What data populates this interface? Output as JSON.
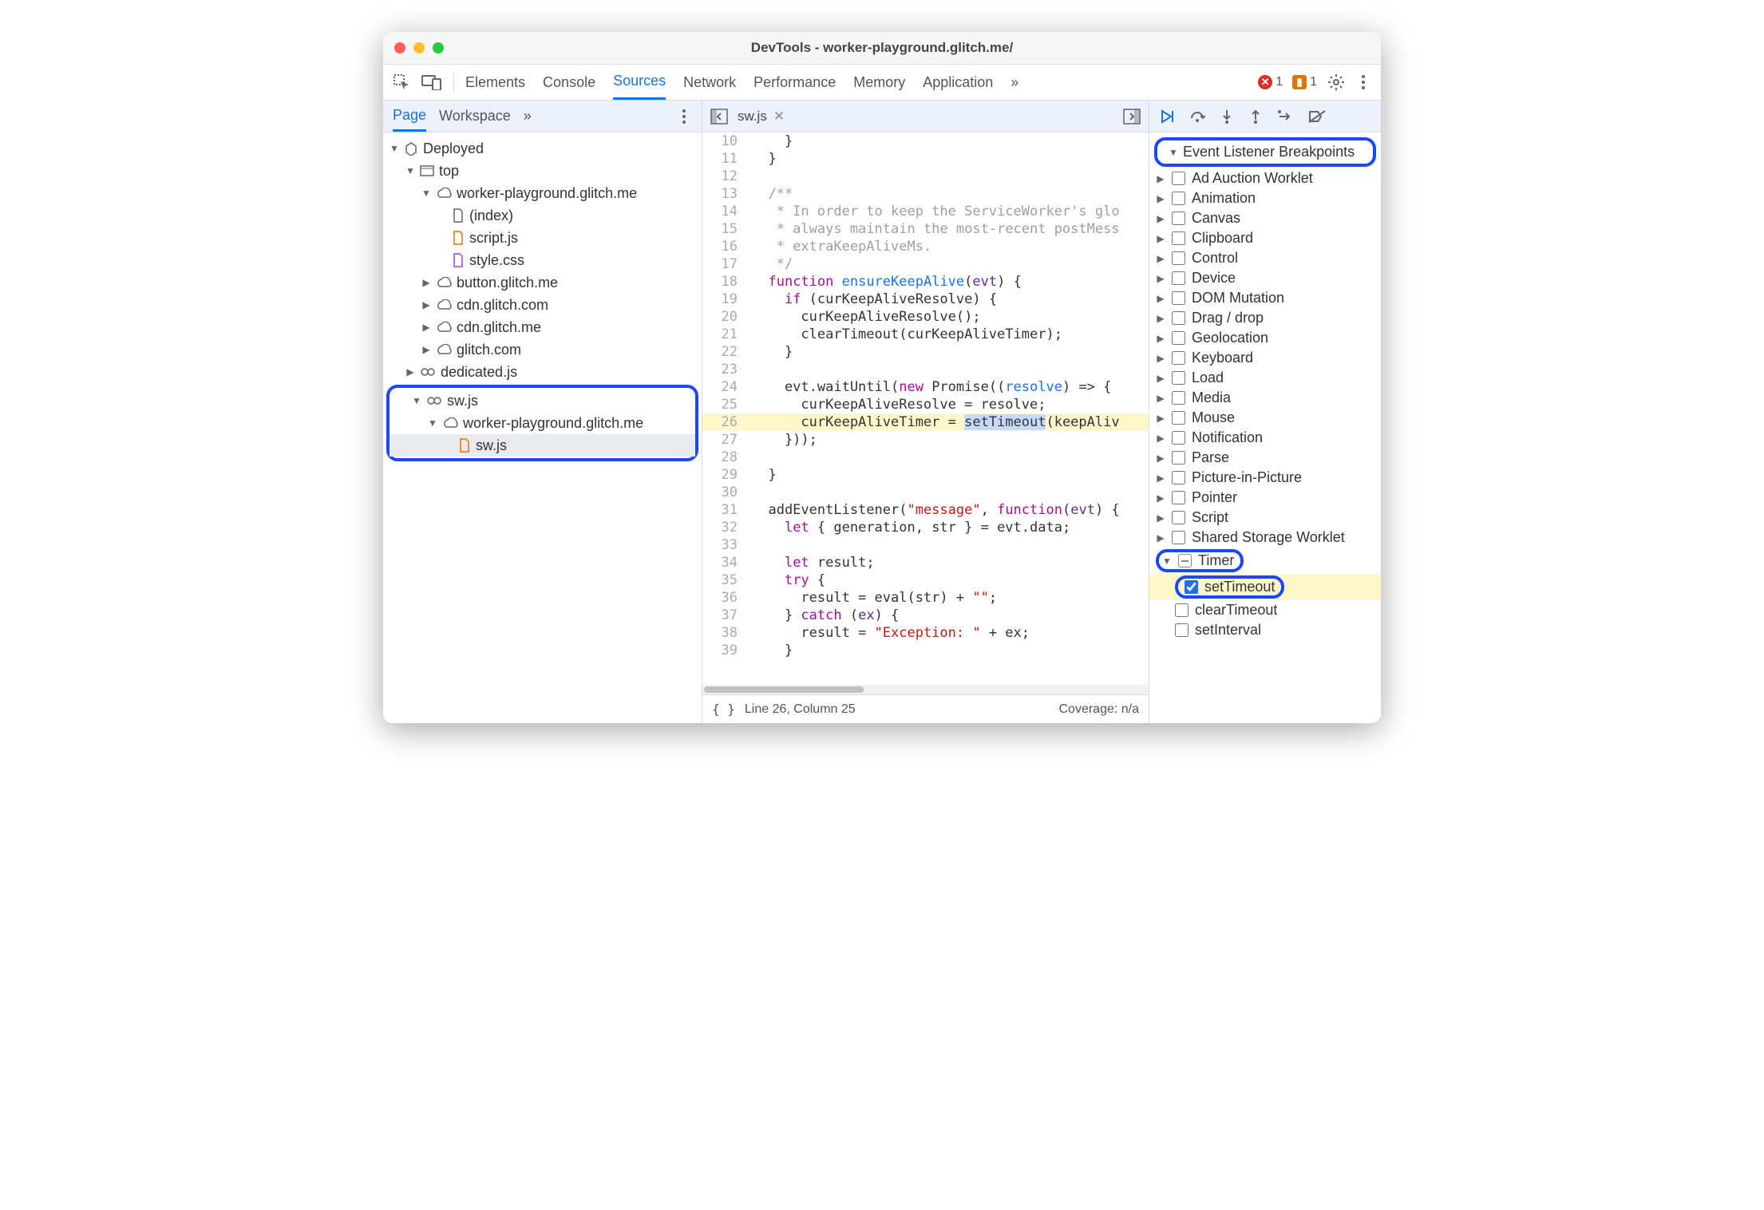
{
  "window": {
    "title": "DevTools - worker-playground.glitch.me/"
  },
  "toolbar": {
    "tabs": [
      "Elements",
      "Console",
      "Sources",
      "Network",
      "Performance",
      "Memory",
      "Application"
    ],
    "active": "Sources",
    "errors": "1",
    "warnings": "1"
  },
  "left": {
    "subtabs": [
      "Page",
      "Workspace"
    ],
    "active": "Page",
    "tree": {
      "root": "Deployed",
      "top": "top",
      "domain_main": "worker-playground.glitch.me",
      "files": [
        "(index)",
        "script.js",
        "style.css"
      ],
      "other_domains": [
        "button.glitch.me",
        "cdn.glitch.com",
        "cdn.glitch.me",
        "glitch.com"
      ],
      "dedicated": "dedicated.js",
      "sw_root": "sw.js",
      "sw_domain": "worker-playground.glitch.me",
      "sw_file": "sw.js"
    }
  },
  "editor": {
    "filename": "sw.js",
    "lines": [
      {
        "n": 10,
        "html": "    }"
      },
      {
        "n": 11,
        "html": "  }"
      },
      {
        "n": 12,
        "html": ""
      },
      {
        "n": 13,
        "html": "  <span class='c-comment'>/**</span>"
      },
      {
        "n": 14,
        "html": "<span class='c-comment'>   * In order to keep the ServiceWorker's glo</span>"
      },
      {
        "n": 15,
        "html": "<span class='c-comment'>   * always maintain the most-recent postMess</span>"
      },
      {
        "n": 16,
        "html": "<span class='c-comment'>   * extraKeepAliveMs.</span>"
      },
      {
        "n": 17,
        "html": "<span class='c-comment'>   */</span>"
      },
      {
        "n": 18,
        "html": "  <span class='c-kw'>function</span> <span class='c-fn'>ensureKeepAlive</span>(<span class='c-arg'>evt</span>) {"
      },
      {
        "n": 19,
        "html": "    <span class='c-kw'>if</span> (curKeepAliveResolve) {"
      },
      {
        "n": 20,
        "html": "      curKeepAliveResolve();"
      },
      {
        "n": 21,
        "html": "      clearTimeout(curKeepAliveTimer);"
      },
      {
        "n": 22,
        "html": "    }"
      },
      {
        "n": 23,
        "html": ""
      },
      {
        "n": 24,
        "html": "    evt.waitUntil(<span class='c-kw'>new</span> Promise((<span class='c-fn'>resolve</span>) => {"
      },
      {
        "n": 25,
        "html": "      curKeepAliveResolve = resolve;"
      },
      {
        "n": 26,
        "html": "      curKeepAliveTimer = <span class='hl-sel'>setTimeout</span>(keepAliv",
        "hl": true
      },
      {
        "n": 27,
        "html": "    }));"
      },
      {
        "n": 28,
        "html": ""
      },
      {
        "n": 29,
        "html": "  }"
      },
      {
        "n": 30,
        "html": ""
      },
      {
        "n": 31,
        "html": "  addEventListener(<span class='c-str'>\"message\"</span>, <span class='c-kw'>function</span>(<span class='c-arg'>evt</span>) {"
      },
      {
        "n": 32,
        "html": "    <span class='c-kw'>let</span> { generation, str } = evt.data;"
      },
      {
        "n": 33,
        "html": ""
      },
      {
        "n": 34,
        "html": "    <span class='c-kw'>let</span> result;"
      },
      {
        "n": 35,
        "html": "    <span class='c-kw'>try</span> {"
      },
      {
        "n": 36,
        "html": "      result = eval(str) + <span class='c-str'>\"\"</span>;"
      },
      {
        "n": 37,
        "html": "    } <span class='c-kw'>catch</span> (<span class='c-arg'>ex</span>) {"
      },
      {
        "n": 38,
        "html": "      result = <span class='c-str'>\"Exception: \"</span> + ex;"
      },
      {
        "n": 39,
        "html": "    }"
      }
    ],
    "status_line": "Line 26, Column 25",
    "coverage": "Coverage: n/a"
  },
  "right": {
    "pane_title": "Event Listener Breakpoints",
    "categories": [
      "Ad Auction Worklet",
      "Animation",
      "Canvas",
      "Clipboard",
      "Control",
      "Device",
      "DOM Mutation",
      "Drag / drop",
      "Geolocation",
      "Keyboard",
      "Load",
      "Media",
      "Mouse",
      "Notification",
      "Parse",
      "Picture-in-Picture",
      "Pointer",
      "Script",
      "Shared Storage Worklet"
    ],
    "timer": {
      "label": "Timer",
      "children": [
        "setTimeout",
        "clearTimeout",
        "setInterval"
      ],
      "checked": "setTimeout"
    }
  }
}
